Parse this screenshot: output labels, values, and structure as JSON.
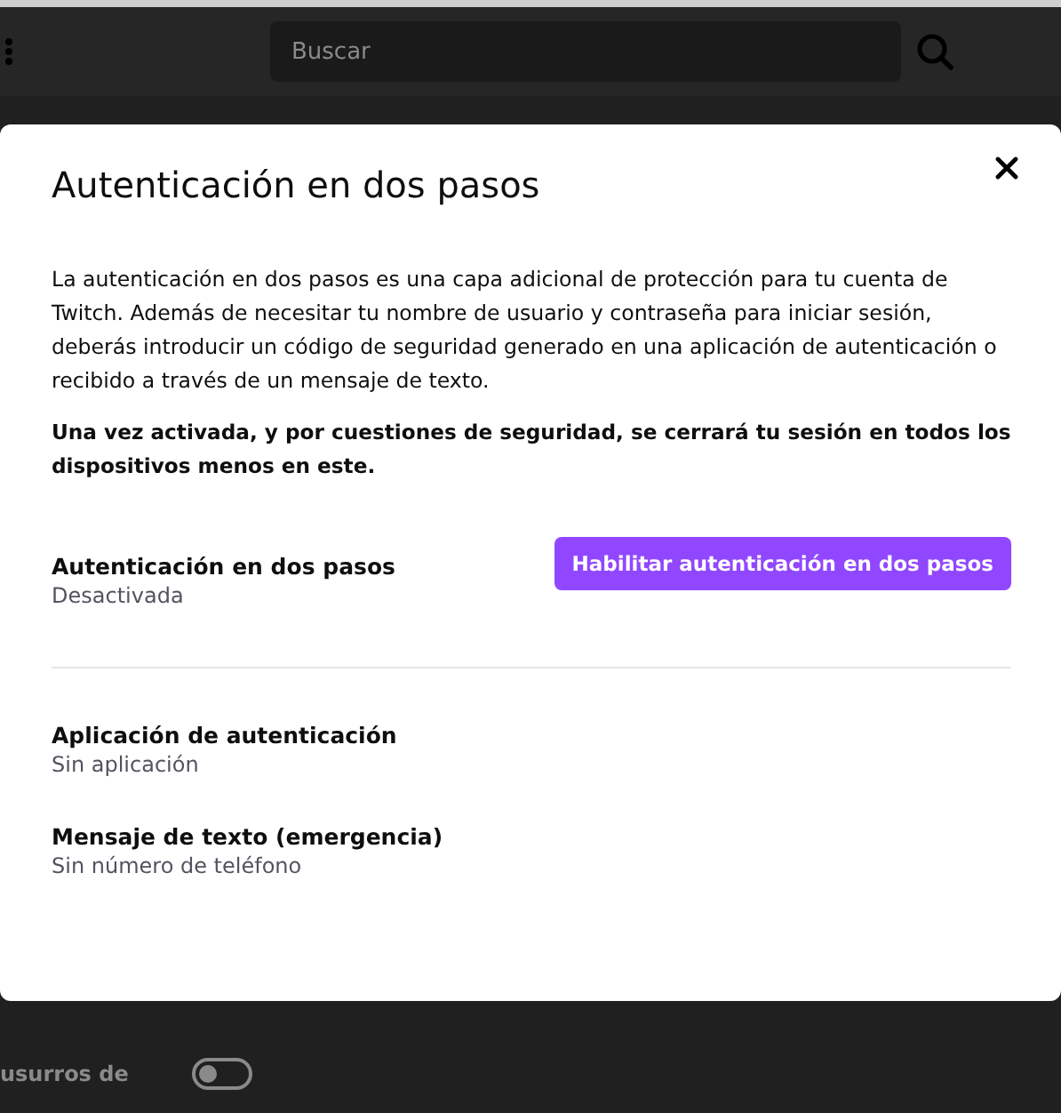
{
  "topbar": {
    "search": {
      "placeholder": "Buscar"
    }
  },
  "modal": {
    "title": "Autenticación en dos pasos",
    "description": "La autenticación en dos pasos es una capa adicional de protección para tu cuenta de Twitch. Además de necesitar tu nombre de usuario y contraseña para iniciar sesión, deberás introducir un código de seguridad generado en una aplicación de autenticación o recibido a través de un mensaje de texto.",
    "warning": "Una vez activada, y por cuestiones de seguridad, se cerrará tu sesión en todos los dispositivos menos en este.",
    "status": {
      "label": "Autenticación en dos pasos",
      "value": "Desactivada",
      "button": "Habilitar autenticación en dos pasos"
    },
    "methods": [
      {
        "label": "Aplicación de autenticación",
        "value": "Sin aplicación"
      },
      {
        "label": "Mensaje de texto (emergencia)",
        "value": "Sin número de teléfono"
      }
    ]
  },
  "background_setting": {
    "label": "usurros de",
    "on": false
  }
}
